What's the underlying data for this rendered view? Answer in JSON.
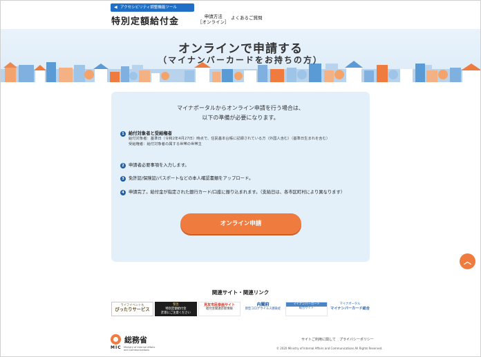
{
  "header": {
    "accessibility_label": "アクセシビリティ調整機能ツール",
    "site_title": "特別定額給付金",
    "nav": [
      {
        "label": "申請方法",
        "sub": "［オンライン］"
      },
      {
        "label": "よくあるご質問"
      }
    ]
  },
  "hero": {
    "title": "オンラインで申請する",
    "subtitle": "（マイナンバーカードをお持ちの方）"
  },
  "card": {
    "intro_line1": "マイナポータルからオンライン申請を行う場合は、",
    "intro_line2": "以下の準備が必要になります。",
    "steps": [
      {
        "number": "1",
        "title": "給付対象者と受給権者",
        "detail1": "給付対象者：基準日（令和2年4月27日）時点で、住民基本台帳に記録されている方（外国人含む）（基準日生まれを含む）",
        "detail2": "受給権者：給付対象者の属する世帯の世帯主"
      },
      {
        "number": "2",
        "title": "申請者必要事項を入力します。"
      },
      {
        "number": "3",
        "title": "免許証/保険証/パスポートなどの本人確認書類をアップロード。"
      },
      {
        "number": "4",
        "title": "申請完了。給付金が指定された銀行カード/口座に振り込まれます。（支給日は、各市区町村により異なります）"
      }
    ],
    "apply_button": "オンライン申請"
  },
  "related": {
    "title": "関連サイト・関連リンク",
    "banners": [
      {
        "line1": "ライフイベントも",
        "line2": "ぴったりサービス"
      },
      {
        "line1": "緊急",
        "line2": "特別定額給付金",
        "line3": "詐欺にご注意ください"
      },
      {
        "line1": "見友市民参画サイト",
        "line2": "給付金関連詐欺情報"
      },
      {
        "line1": "内閣府",
        "line2": "新型コロナウイルス感染症"
      },
      {
        "line1": "マイナンバーカード",
        "line2": "総合サイト"
      },
      {
        "line1": "マイナポータル",
        "line2": "マイナンバーカード総合"
      }
    ]
  },
  "footer": {
    "ministry": "総務省",
    "mic": "MIC",
    "mic_sub1": "Ministry of Internal Affairs",
    "mic_sub2": "and Communications",
    "link_1": "サイトご利用に関して",
    "link_2": "プライバシーポリシー",
    "copyright": "© 2020 Ministry of Internal Affairs and Communications All Rights Reserved."
  },
  "colors": {
    "accent": "#f07b3f",
    "card_bg": "#e3f0fa",
    "header_blue": "#1f6fc6"
  }
}
